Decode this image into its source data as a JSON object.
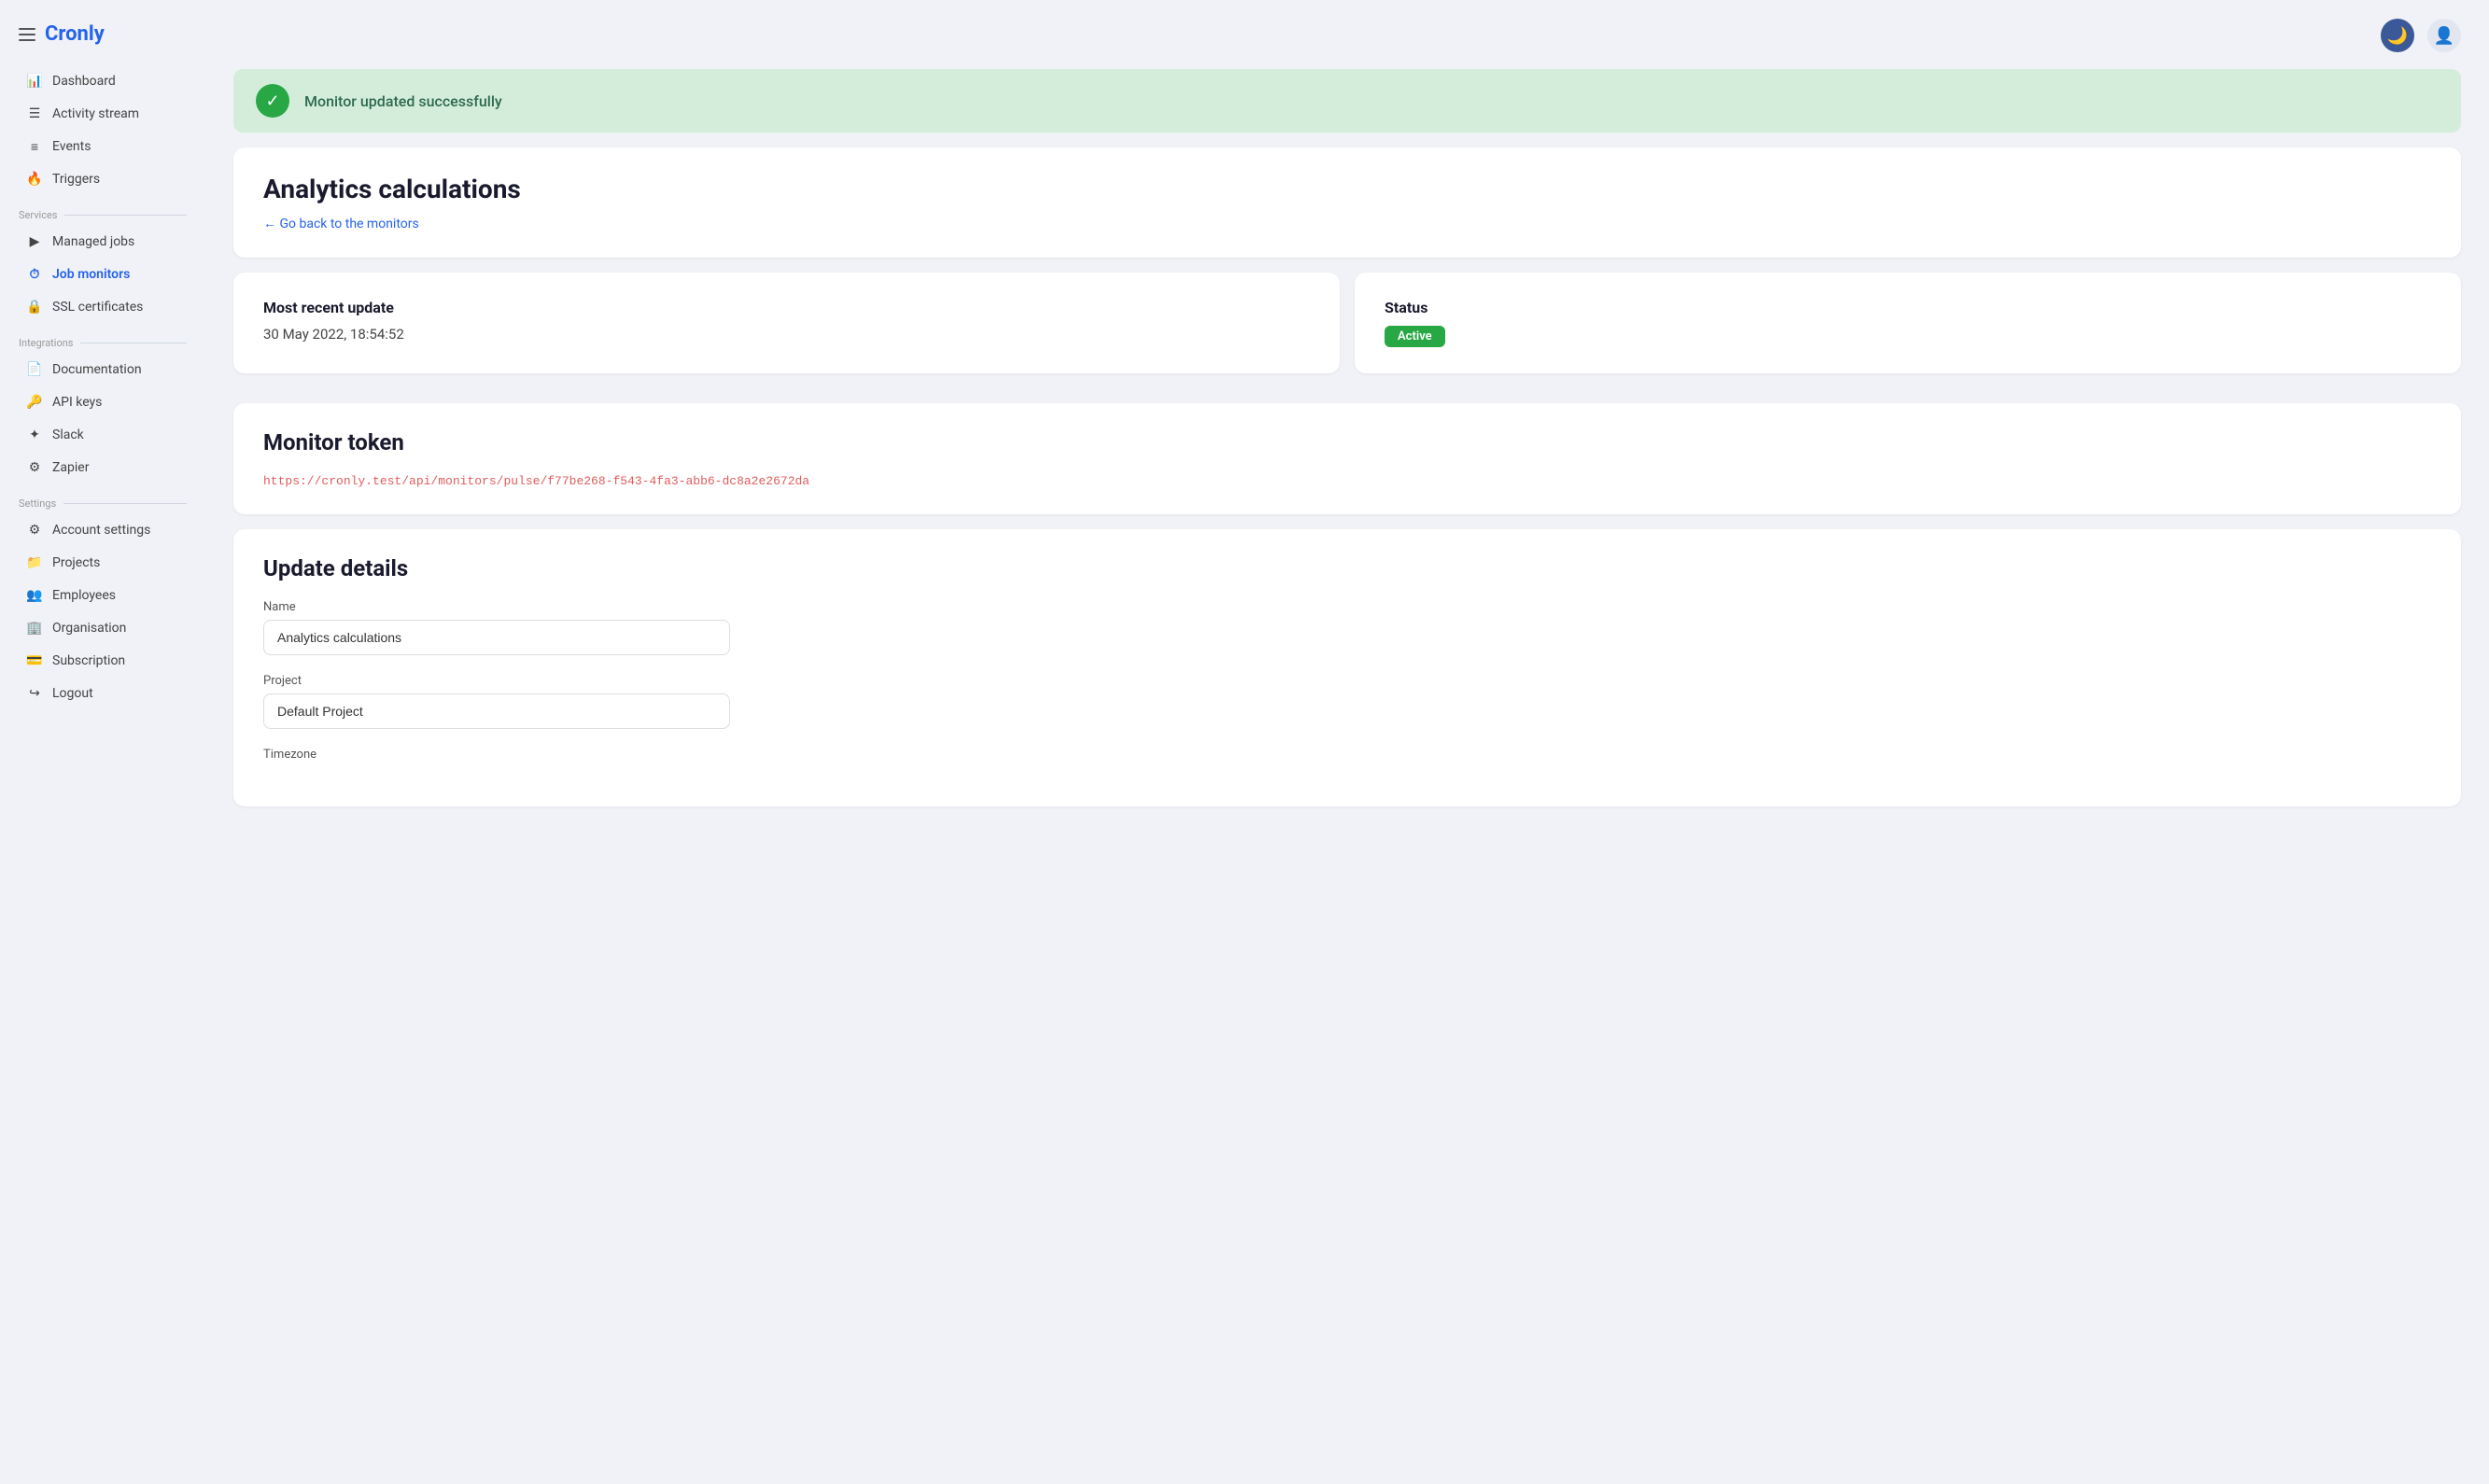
{
  "app": {
    "logo": "Cronly"
  },
  "topbar": {
    "moon_icon": "🌙",
    "user_icon": "👤"
  },
  "sidebar": {
    "main_nav": [
      {
        "id": "dashboard",
        "label": "Dashboard",
        "icon": "📊"
      },
      {
        "id": "activity-stream",
        "label": "Activity stream",
        "icon": "☰"
      },
      {
        "id": "events",
        "label": "Events",
        "icon": "≡"
      },
      {
        "id": "triggers",
        "label": "Triggers",
        "icon": "🔥"
      }
    ],
    "services_label": "Services",
    "services_nav": [
      {
        "id": "managed-jobs",
        "label": "Managed jobs",
        "icon": "▶"
      },
      {
        "id": "job-monitors",
        "label": "Job monitors",
        "icon": "⏱",
        "active": true
      },
      {
        "id": "ssl-certificates",
        "label": "SSL certificates",
        "icon": "🔒"
      }
    ],
    "integrations_label": "Integrations",
    "integrations_nav": [
      {
        "id": "documentation",
        "label": "Documentation",
        "icon": "📄"
      },
      {
        "id": "api-keys",
        "label": "API keys",
        "icon": "🔑"
      },
      {
        "id": "slack",
        "label": "Slack",
        "icon": "✦"
      },
      {
        "id": "zapier",
        "label": "Zapier",
        "icon": "⚙"
      }
    ],
    "settings_label": "Settings",
    "settings_nav": [
      {
        "id": "account-settings",
        "label": "Account settings",
        "icon": "⚙"
      },
      {
        "id": "projects",
        "label": "Projects",
        "icon": "📁"
      },
      {
        "id": "employees",
        "label": "Employees",
        "icon": "👥"
      },
      {
        "id": "organisation",
        "label": "Organisation",
        "icon": "🏢"
      },
      {
        "id": "subscription",
        "label": "Subscription",
        "icon": "💳"
      },
      {
        "id": "logout",
        "label": "Logout",
        "icon": "↪"
      }
    ]
  },
  "success_banner": {
    "message": "Monitor updated successfully"
  },
  "monitor": {
    "title": "Analytics calculations",
    "back_link": "← Go back to the monitors",
    "most_recent_update_label": "Most recent update",
    "most_recent_update_value": "30 May 2022, 18:54:52",
    "status_label": "Status",
    "status_value": "Active",
    "monitor_token_label": "Monitor token",
    "token_url": "https://cronly.test/api/monitors/pulse/f77be268-f543-4fa3-abb6-dc8a2e2672da",
    "update_details_label": "Update details",
    "name_label": "Name",
    "name_value": "Analytics calculations",
    "project_label": "Project",
    "project_value": "Default Project",
    "timezone_label": "Timezone"
  }
}
